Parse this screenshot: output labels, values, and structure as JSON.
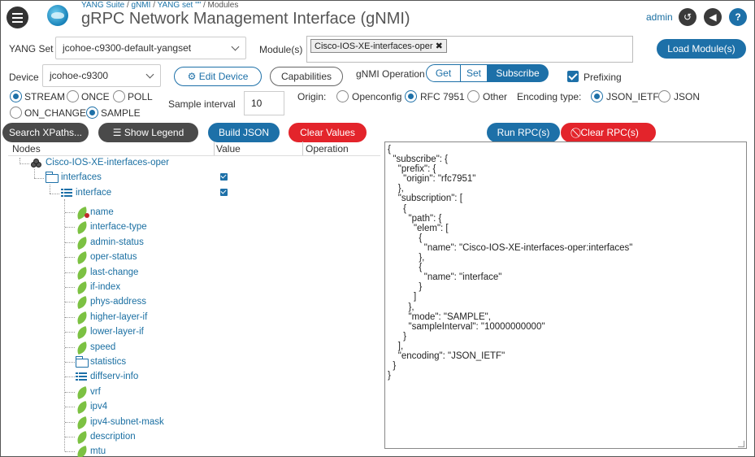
{
  "header": {
    "breadcrumb": [
      "YANG Suite",
      "gNMI",
      "YANG set \"\"",
      "Modules"
    ],
    "title": "gRPC Network Management Interface (gNMI)",
    "user": "admin",
    "help": "?"
  },
  "yangset": {
    "label": "YANG Set",
    "value": "jcohoe-c9300-default-yangset",
    "modules_label": "Module(s)",
    "selected_module": "Cisco-IOS-XE-interfaces-oper",
    "load_button": "Load Module(s)"
  },
  "device": {
    "label": "Device",
    "value": "jcohoe-c9300",
    "edit_button": "Edit Device",
    "capabilities_button": "Capabilities"
  },
  "operation": {
    "label": "gNMI Operation",
    "options": [
      "Get",
      "Set",
      "Subscribe"
    ],
    "selected": "Subscribe",
    "prefixing_label": "Prefixing",
    "prefixing_checked": true
  },
  "subscribe_mode": {
    "options": [
      "STREAM",
      "ONCE",
      "POLL",
      "ON_CHANGE",
      "SAMPLE"
    ],
    "selected": [
      "STREAM",
      "SAMPLE"
    ],
    "sample_interval_label": "Sample interval",
    "sample_interval_value": "10"
  },
  "origin": {
    "label": "Origin:",
    "options": [
      "Openconfig",
      "RFC 7951",
      "Other"
    ],
    "selected": "RFC 7951"
  },
  "encoding": {
    "label": "Encoding type:",
    "options": [
      "JSON_IETF",
      "JSON"
    ],
    "selected": "JSON_IETF"
  },
  "actions": {
    "search_xpaths": "Search XPaths...",
    "show_legend": "Show Legend",
    "build_json": "Build JSON",
    "clear_values": "Clear Values",
    "run_rpc": "Run RPC(s)",
    "clear_rpc": "Clear RPC(s)"
  },
  "tree": {
    "columns": [
      "Nodes",
      "Value",
      "Operation"
    ],
    "root": "Cisco-IOS-XE-interfaces-oper",
    "container": "interfaces",
    "list": "interface",
    "children": [
      "name",
      "interface-type",
      "admin-status",
      "oper-status",
      "last-change",
      "if-index",
      "phys-address",
      "higher-layer-if",
      "lower-layer-if",
      "speed",
      "statistics",
      "diffserv-info",
      "vrf",
      "ipv4",
      "ipv4-subnet-mask",
      "description",
      "mtu"
    ]
  },
  "json_output": "{\n  \"subscribe\": {\n    \"prefix\": {\n      \"origin\": \"rfc7951\"\n    },\n    \"subscription\": [\n      {\n        \"path\": {\n          \"elem\": [\n            {\n              \"name\": \"Cisco-IOS-XE-interfaces-oper:interfaces\"\n            },\n            {\n              \"name\": \"interface\"\n            }\n          ]\n        },\n        \"mode\": \"SAMPLE\",\n        \"sampleInterval\": \"10000000000\"\n      }\n    ],\n    \"encoding\": \"JSON_IETF\"\n  }\n}",
  "colors": {
    "accent": "#1d70a8",
    "danger": "#e3242b",
    "leaf": "#7cc142"
  }
}
